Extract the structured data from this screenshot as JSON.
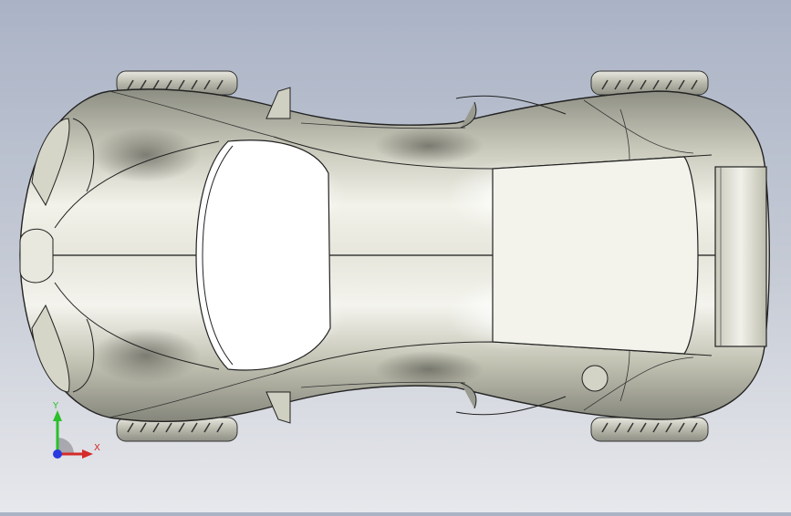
{
  "viewport": {
    "background_top": "#aab3c6",
    "background_bottom": "#e7e8ec",
    "model": "car-body-top-view",
    "body_color": "#d8d8cc",
    "edge_color": "#2a2a2a"
  },
  "triad": {
    "y_label": "Y",
    "x_label": "X",
    "y_color": "#2bbf2b",
    "x_color": "#d42a2a",
    "z_color": "#2a3adf"
  }
}
